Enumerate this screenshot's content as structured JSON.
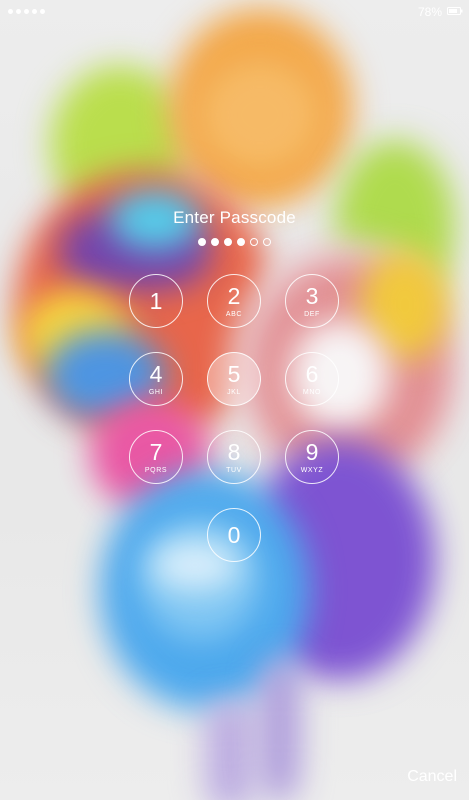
{
  "status_bar": {
    "battery_percent": "78%",
    "signal_dots": 5,
    "text_color": "#ffffff"
  },
  "lock_screen": {
    "prompt": "Enter Passcode",
    "passcode_length": 6,
    "digits_entered": 4,
    "keys": [
      {
        "digit": "1",
        "letters": ""
      },
      {
        "digit": "2",
        "letters": "ABC"
      },
      {
        "digit": "3",
        "letters": "DEF"
      },
      {
        "digit": "4",
        "letters": "GHI"
      },
      {
        "digit": "5",
        "letters": "JKL"
      },
      {
        "digit": "6",
        "letters": "MNO"
      },
      {
        "digit": "7",
        "letters": "PQRS"
      },
      {
        "digit": "8",
        "letters": "TUV"
      },
      {
        "digit": "9",
        "letters": "WXYZ"
      },
      {
        "digit": "0",
        "letters": ""
      }
    ],
    "pressed_key": "5",
    "cancel_label": "Cancel"
  },
  "wallpaper": {
    "subject": "balloons",
    "colors": [
      "#f2a13b",
      "#b5dc3e",
      "#e65a3c",
      "#3fa2ec",
      "#7346cf",
      "#e84a9d",
      "#f5d230"
    ]
  }
}
